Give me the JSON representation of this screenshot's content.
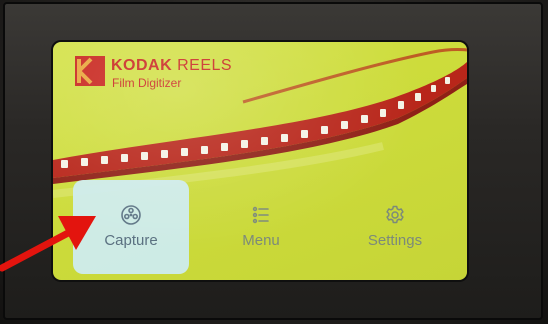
{
  "device": {
    "brand": "KODAK",
    "product": "REELS",
    "subtitle": "Film Digitizer"
  },
  "colors": {
    "screen_bg": "#cddc3b",
    "brand_red": "#c8241c",
    "film_red": "#b8261a",
    "selected_tile": "#cdecf2",
    "annotation_arrow": "#e3140e"
  },
  "menu": {
    "items": [
      {
        "label": "Capture",
        "icon": "film-reel-icon",
        "selected": true
      },
      {
        "label": "Menu",
        "icon": "list-icon",
        "selected": false
      },
      {
        "label": "Settings",
        "icon": "gear-icon",
        "selected": false
      }
    ]
  },
  "annotation": {
    "icon": "red-arrow-icon",
    "points_to": "Capture"
  }
}
